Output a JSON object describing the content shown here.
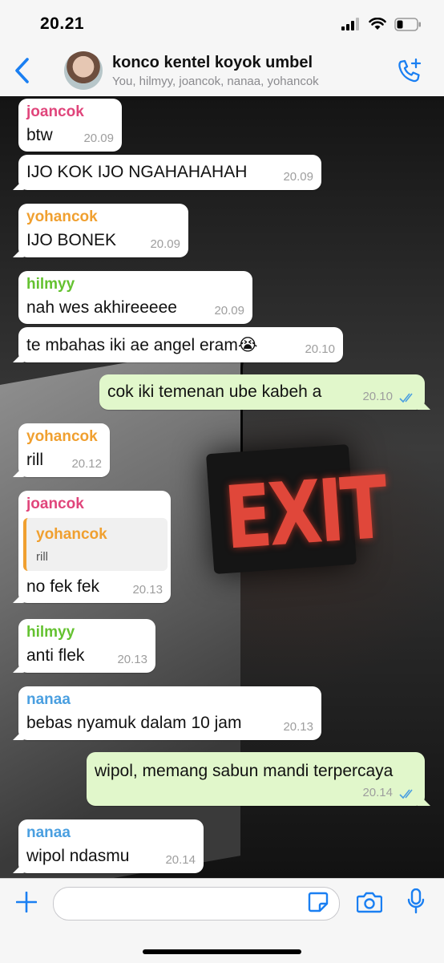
{
  "status_bar": {
    "time": "20.21",
    "signal_icon": "signal-icon",
    "wifi_icon": "wifi-icon",
    "battery_icon": "battery-icon"
  },
  "header": {
    "title": "konco kentel koyok umbel",
    "subtitle": "You, hilmyy, joancok, nanaa, yohancok",
    "accent": "#1a7ff2"
  },
  "colors": {
    "joancok": "#e0457b",
    "yohancok": "#f0a030",
    "hilmyy": "#64c230",
    "nanaa": "#4a9fe0",
    "outgoing_bubble": "#e1f7cb",
    "incoming_bubble": "#ffffff"
  },
  "background": {
    "sign_text": "EXIT"
  },
  "messages": [
    {
      "sender": "joancok",
      "text": "btw",
      "time": "20.09"
    },
    {
      "sender": "",
      "text": "IJO KOK IJO NGAHAHAHAH",
      "time": "20.09"
    },
    {
      "sender": "yohancok",
      "text": "IJO BONEK",
      "time": "20.09"
    },
    {
      "sender": "hilmyy",
      "text": "nah wes akhireeeee",
      "time": "20.09"
    },
    {
      "sender": "",
      "text": "te mbahas iki ae angel eram😭",
      "time": "20.10"
    },
    {
      "sender": "",
      "text": "cok iki temenan ube kabeh a",
      "time": "20.10",
      "outgoing": true
    },
    {
      "sender": "yohancok",
      "text": "rill",
      "time": "20.12"
    },
    {
      "sender": "joancok",
      "text": "no fek fek",
      "time": "20.13",
      "quote": {
        "sender": "yohancok",
        "text": "rill"
      }
    },
    {
      "sender": "hilmyy",
      "text": "anti flek",
      "time": "20.13"
    },
    {
      "sender": "nanaa",
      "text": "bebas nyamuk dalam 10 jam",
      "time": "20.13"
    },
    {
      "sender": "",
      "text": "wipol, memang sabun mandi terpercaya",
      "time": "20.14",
      "outgoing": true
    },
    {
      "sender": "nanaa",
      "text": "wipol ndasmu",
      "time": "20.14"
    }
  ],
  "input": {
    "placeholder": "",
    "value": ""
  }
}
